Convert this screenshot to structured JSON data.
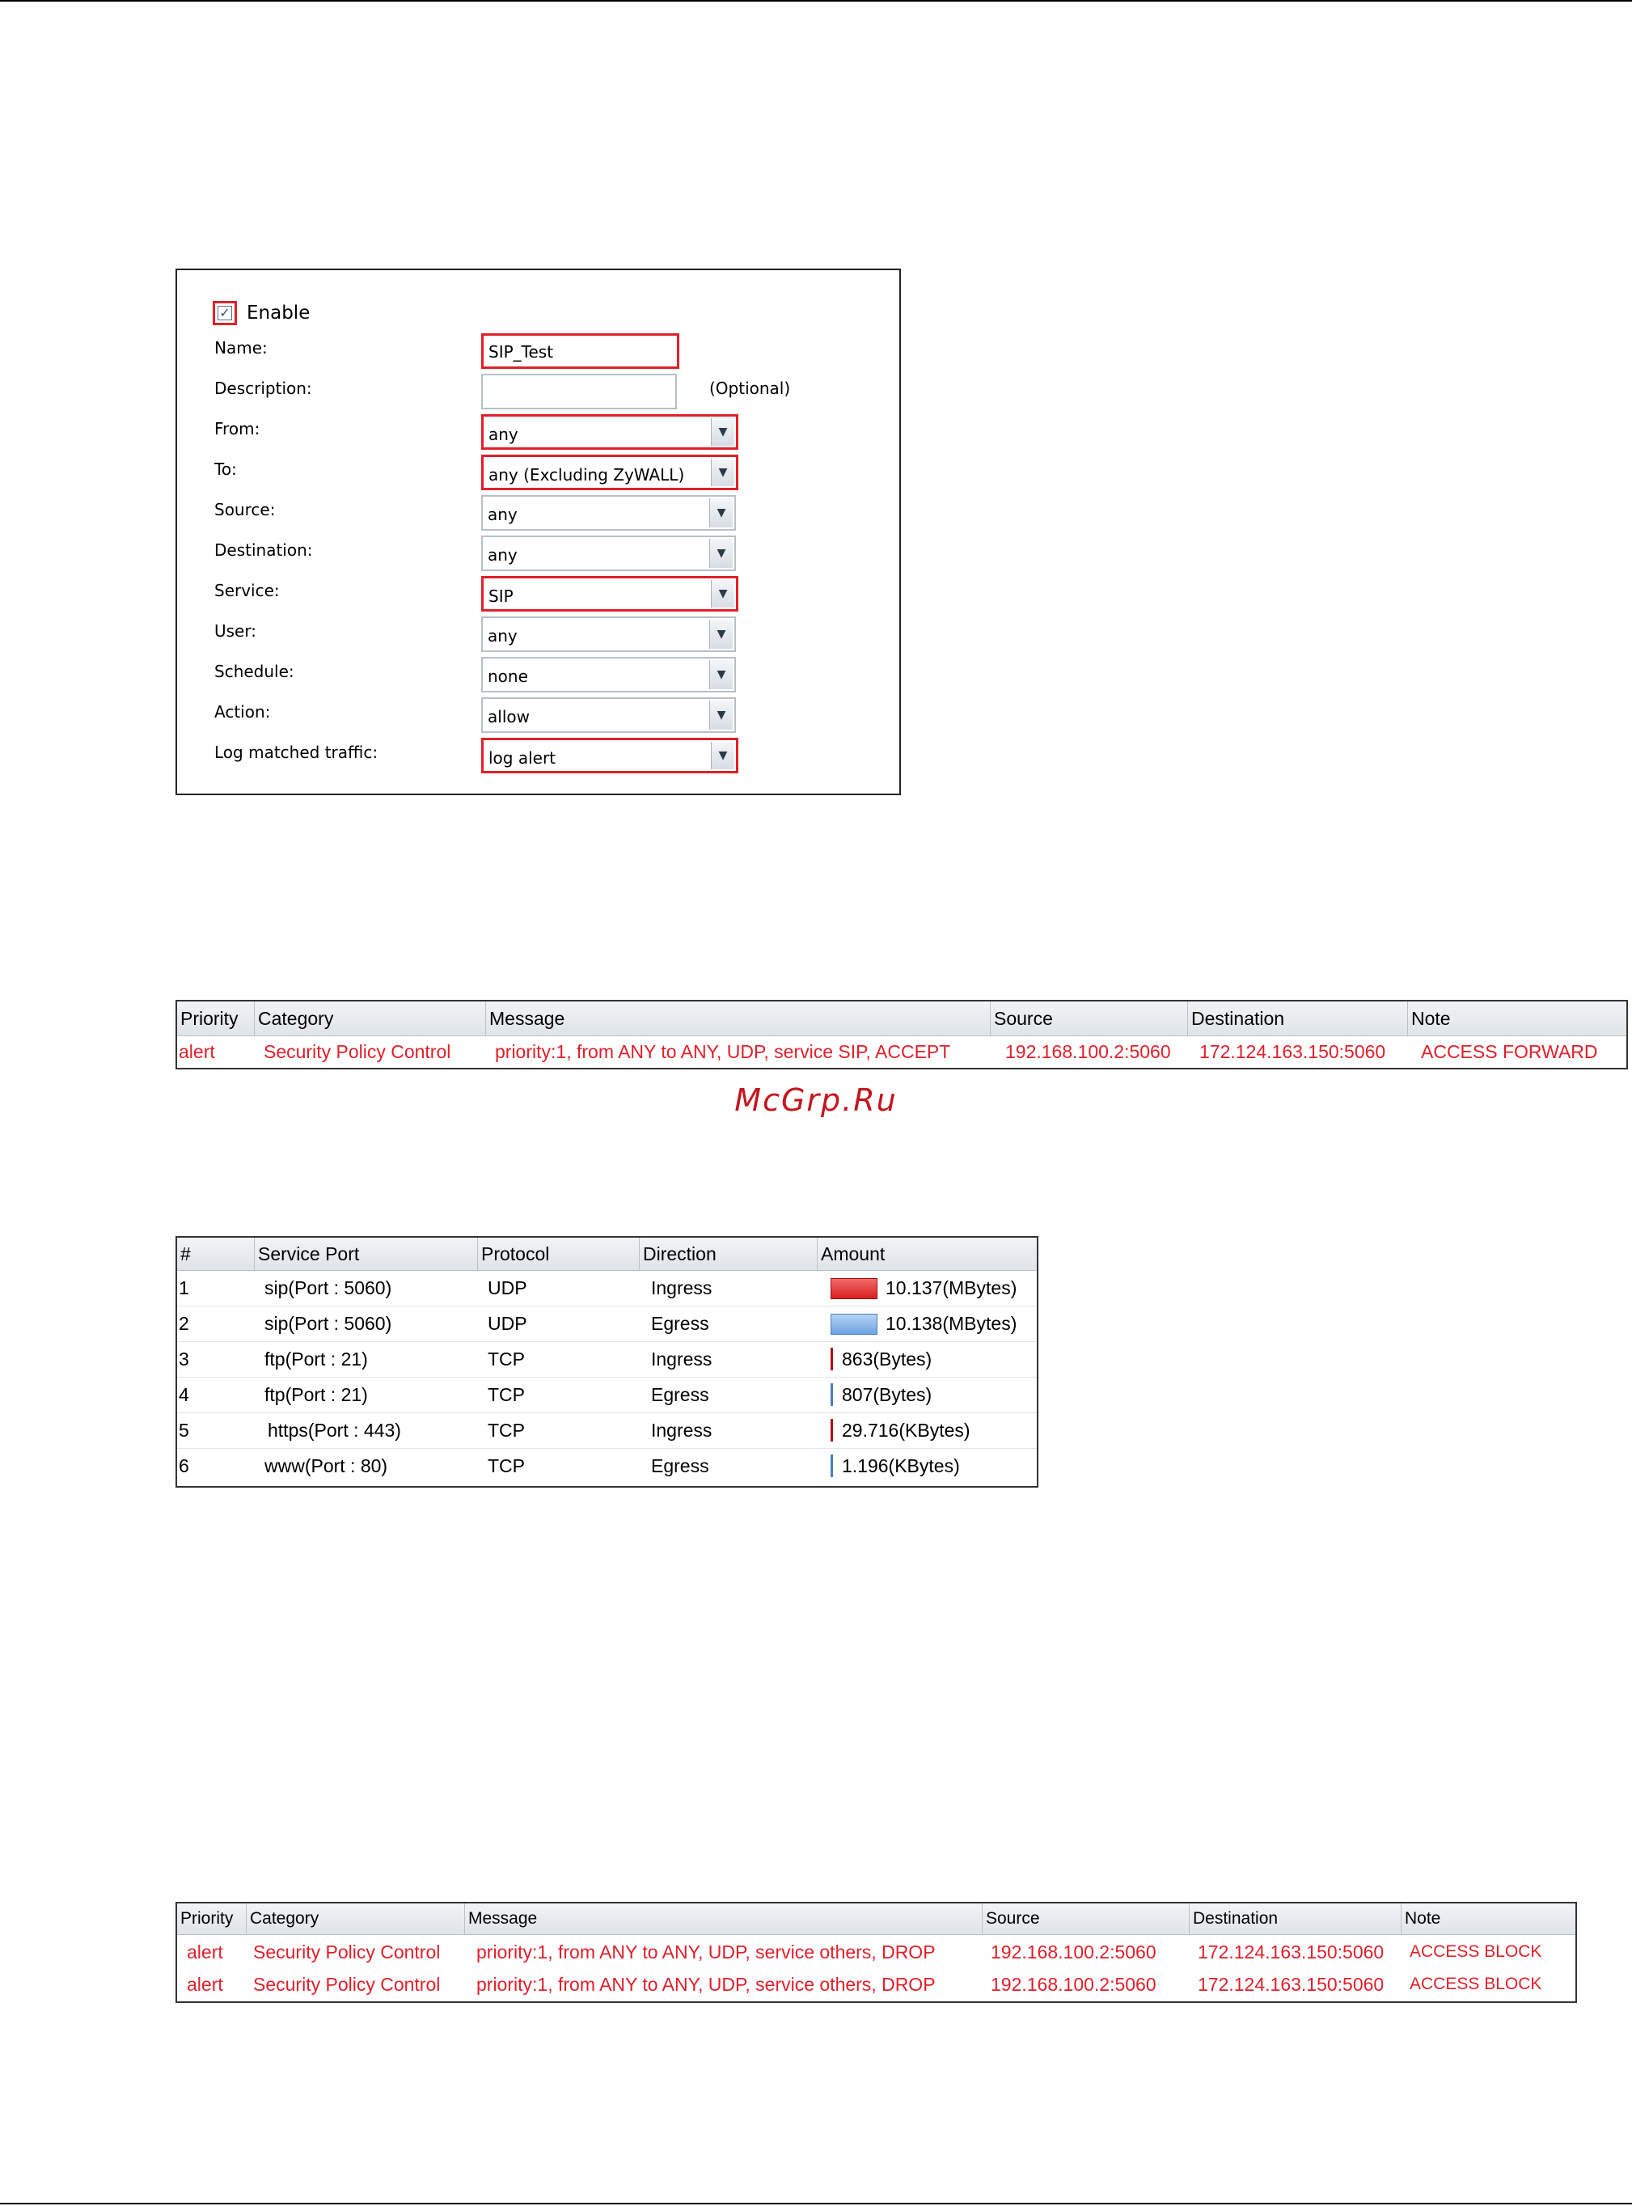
{
  "policy_form": {
    "enable_label": "Enable",
    "enable_checked": true,
    "name": {
      "label": "Name:",
      "value": "SIP_Test"
    },
    "description": {
      "label": "Description:",
      "value": "",
      "hint": "(Optional)"
    },
    "from": {
      "label": "From:",
      "value": "any"
    },
    "to": {
      "label": "To:",
      "value": "any (Excluding ZyWALL)"
    },
    "source": {
      "label": "Source:",
      "value": "any"
    },
    "destination": {
      "label": "Destination:",
      "value": "any"
    },
    "service": {
      "label": "Service:",
      "value": "SIP"
    },
    "user": {
      "label": "User:",
      "value": "any"
    },
    "schedule": {
      "label": "Schedule:",
      "value": "none"
    },
    "action": {
      "label": "Action:",
      "value": "allow"
    },
    "log": {
      "label": "Log matched traffic:",
      "value": "log alert"
    }
  },
  "log_table_1": {
    "headers": [
      "Priority",
      "Category",
      "Message",
      "Source",
      "Destination",
      "Note"
    ],
    "rows": [
      [
        "alert",
        "Security Policy Control",
        "priority:1, from ANY to ANY, UDP, service SIP, ACCEPT",
        "192.168.100.2:5060",
        "172.124.163.150:5060",
        "ACCESS FORWARD"
      ]
    ]
  },
  "watermark": "McGrp.Ru",
  "usage_table": {
    "headers": [
      "#",
      "Service Port",
      "Protocol",
      "Direction",
      "Amount"
    ],
    "rows": [
      {
        "num": "1",
        "port": "sip(Port : 5060)",
        "protocol": "UDP",
        "direction": "Ingress",
        "amount": "10.137(MBytes)"
      },
      {
        "num": "2",
        "port": "sip(Port : 5060)",
        "protocol": "UDP",
        "direction": "Egress",
        "amount": "10.138(MBytes)"
      },
      {
        "num": "3",
        "port": "ftp(Port : 21)",
        "protocol": "TCP",
        "direction": "Ingress",
        "amount": "863(Bytes)"
      },
      {
        "num": "4",
        "port": "ftp(Port : 21)",
        "protocol": "TCP",
        "direction": "Egress",
        "amount": "807(Bytes)"
      },
      {
        "num": "5",
        "port": "https(Port : 443)",
        "protocol": "TCP",
        "direction": "Ingress",
        "amount": "29.716(KBytes)"
      },
      {
        "num": "6",
        "port": "www(Port : 80)",
        "protocol": "TCP",
        "direction": "Egress",
        "amount": "1.196(KBytes)"
      }
    ]
  },
  "log_table_2": {
    "headers": [
      "Priority",
      "Category",
      "Message",
      "Source",
      "Destination",
      "Note"
    ],
    "rows": [
      [
        "alert",
        "Security Policy Control",
        "priority:1, from ANY to ANY, UDP, service others, DROP",
        "192.168.100.2:5060",
        "172.124.163.150:5060",
        "ACCESS BLOCK"
      ],
      [
        "alert",
        "Security Policy Control",
        "priority:1, from ANY to ANY, UDP, service others, DROP",
        "192.168.100.2:5060",
        "172.124.163.150:5060",
        "ACCESS BLOCK"
      ]
    ]
  },
  "colors": {
    "highlight": "#e0202a",
    "alert_text": "#e0202a",
    "ingress_bar": "#d82020",
    "egress_bar": "#6ea3e2"
  }
}
